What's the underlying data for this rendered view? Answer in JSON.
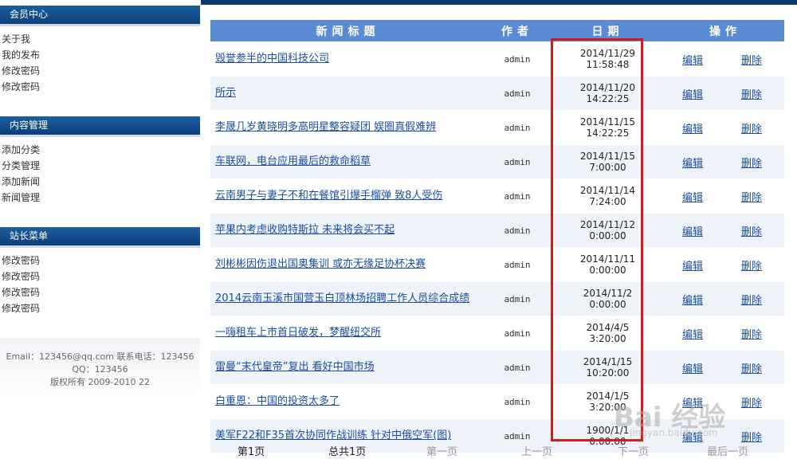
{
  "sidebar": {
    "sections": [
      {
        "title": "会员中心",
        "links": [
          "关于我",
          "我的发布",
          "修改密码",
          "修改密码"
        ]
      },
      {
        "title": "内容管理",
        "links": [
          "添加分类",
          "分类管理",
          "添加新闻",
          "新闻管理"
        ]
      },
      {
        "title": "站长菜单",
        "links": [
          "修改密码",
          "修改密码",
          "修改密码",
          "修改密码"
        ]
      }
    ],
    "footer": {
      "line1": "Email：123456@qq.com 联系电话：123456",
      "line2": "QQ：123456",
      "line3": "版权所有 2009-2010 22"
    }
  },
  "table": {
    "headers": {
      "title": "新闻标题",
      "author": "作者",
      "date": "日期",
      "ops": "操作"
    },
    "rows": [
      {
        "title": "毁誉参半的中国科技公司",
        "author": "admin",
        "date1": "2014/11/29",
        "date2": "11:58:48",
        "edit": "编辑",
        "del": "删除"
      },
      {
        "title": "所示",
        "author": "admin",
        "date1": "2014/11/20",
        "date2": "14:22:25",
        "edit": "编辑",
        "del": "删除"
      },
      {
        "title": "李晟几岁黄晓明多高明星整容疑团 娱圈真假难辨",
        "author": "admin",
        "date1": "2014/11/15",
        "date2": "14:22:25",
        "edit": "编辑",
        "del": "删除"
      },
      {
        "title": "车联网，电台应用最后的救命稻草",
        "author": "admin",
        "date1": "2014/11/15",
        "date2": "7:00:00",
        "edit": "编辑",
        "del": "删除"
      },
      {
        "title": "云南男子与妻子不和在餐馆引爆手榴弹 致8人受伤",
        "author": "admin",
        "date1": "2014/11/14",
        "date2": "7:24:00",
        "edit": "编辑",
        "del": "删除"
      },
      {
        "title": "苹果内考虑收购特斯拉 未来将会买不起",
        "author": "admin",
        "date1": "2014/11/12",
        "date2": "0:00:00",
        "edit": "编辑",
        "del": "删除"
      },
      {
        "title": "刘彬彬因伤退出国奥集训 或亦无缘足协杯决赛",
        "author": "admin",
        "date1": "2014/11/11",
        "date2": "0:00:00",
        "edit": "编辑",
        "del": "删除"
      },
      {
        "title": "2014云南玉溪市国营玉白顶林场招聘工作人员综合成绩",
        "author": "admin",
        "date1": "2014/11/2",
        "date2": "0:00:00",
        "edit": "编辑",
        "del": "删除"
      },
      {
        "title": "一嗨租车上市首日破发，梦醒纽交所",
        "author": "admin",
        "date1": "2014/4/5",
        "date2": "3:20:00",
        "edit": "编辑",
        "del": "删除"
      },
      {
        "title": "雷曼“末代皇帝”复出 看好中国市场",
        "author": "admin",
        "date1": "2014/1/15",
        "date2": "10:20:00",
        "edit": "编辑",
        "del": "删除"
      },
      {
        "title": "白重恩：中国的投资太多了",
        "author": "admin",
        "date1": "2014/1/5",
        "date2": "3:20:00",
        "edit": "编辑",
        "del": "删除"
      },
      {
        "title": "美军F22和F35首次协同作战训练 针对中俄空军(图)",
        "author": "admin",
        "date1": "1900/1/1",
        "date2": "0:00:00",
        "edit": "编辑",
        "del": "删除"
      }
    ]
  },
  "pager": {
    "current": "第1页",
    "total": "总共1页",
    "first": "第一页",
    "prev": "上一页",
    "next": "下一页",
    "last": "最后一页"
  },
  "watermark": {
    "main": "Bai 经验",
    "sub": "jingyan.baidu.com"
  },
  "colors": {
    "header_bg": "#5b8bd3",
    "sidebar_header": "#0b3f78",
    "highlight": "#d21c1c",
    "link": "#1a4fa0"
  }
}
